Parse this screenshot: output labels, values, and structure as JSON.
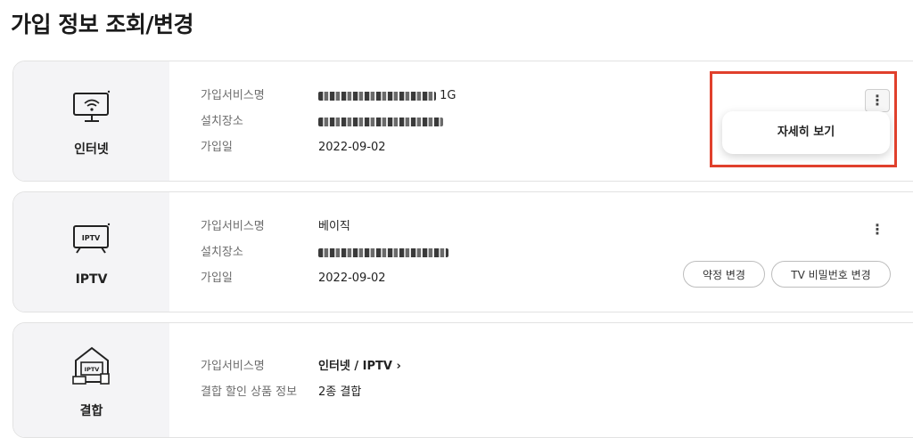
{
  "page": {
    "title": "가입 정보 조회/변경"
  },
  "labels": {
    "subscription_service": "가입서비스명",
    "install_location": "설치장소",
    "join_date": "가입일",
    "bundle_discount": "결합 할인 상품 정보"
  },
  "internet": {
    "name": "인터넷",
    "service_suffix": "1G",
    "join_date": "2022-09-02",
    "popup_label": "자세히 보기"
  },
  "iptv": {
    "name": "IPTV",
    "icon_text": "IPTV",
    "service": "베이직",
    "join_date": "2022-09-02",
    "btn_contract": "약정 변경",
    "btn_password": "TV 비밀번호 변경"
  },
  "bundle": {
    "name": "결합",
    "icon_text": "IPTV",
    "service": "인터넷 / IPTV",
    "service_arrow": "›",
    "discount": "2종 결합"
  },
  "icons": {
    "more": "⋮",
    "colors": {
      "highlight": "#e0402c"
    }
  }
}
